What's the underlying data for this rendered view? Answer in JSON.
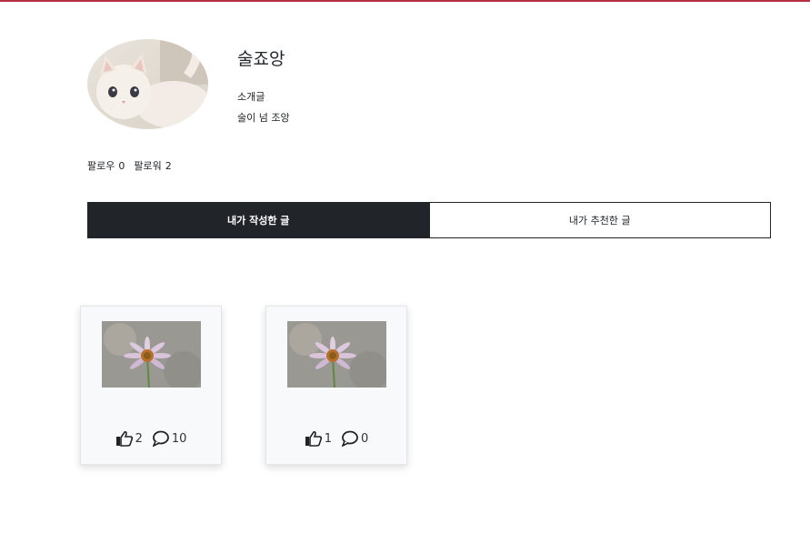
{
  "profile": {
    "nickname": "술죠앙",
    "intro_label": "소개글",
    "intro_text": "술이 넘 조앙",
    "following_label": "팔로우",
    "following_count": "0",
    "follower_label": "팔로워",
    "follower_count": "2"
  },
  "tabs": [
    {
      "label": "내가 작성한 글",
      "active": true
    },
    {
      "label": "내가 추천한 글",
      "active": false
    }
  ],
  "posts": [
    {
      "likes": "2",
      "comments": "10",
      "like_icon": "thumbs-up-icon",
      "comment_icon": "comment-icon"
    },
    {
      "likes": "1",
      "comments": "0",
      "like_icon": "thumbs-up-icon",
      "comment_icon": "comment-icon"
    }
  ],
  "colors": {
    "accent_line": "#b52f3f",
    "tab_active_bg": "#212529"
  }
}
